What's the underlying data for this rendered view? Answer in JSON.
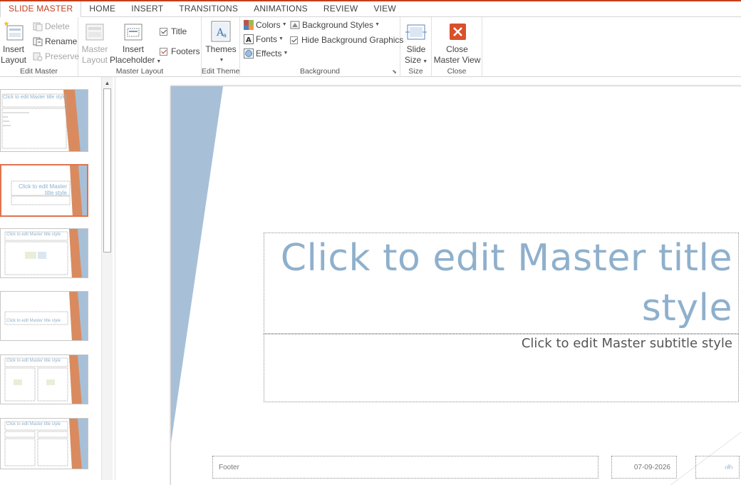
{
  "tabs": [
    "SLIDE MASTER",
    "HOME",
    "INSERT",
    "TRANSITIONS",
    "ANIMATIONS",
    "REVIEW",
    "VIEW"
  ],
  "ribbon": {
    "edit_master": {
      "label": "Edit Master",
      "insert_layout_1": "Insert",
      "insert_layout_2": "Layout",
      "delete": "Delete",
      "rename": "Rename",
      "preserve": "Preserve"
    },
    "master_layout": {
      "label": "Master Layout",
      "master_layout_1": "Master",
      "master_layout_2": "Layout",
      "insert_placeholder_1": "Insert",
      "insert_placeholder_2": "Placeholder",
      "title": "Title",
      "footers": "Footers"
    },
    "edit_theme": {
      "label": "Edit Theme",
      "themes": "Themes"
    },
    "background": {
      "label": "Background",
      "colors": "Colors",
      "fonts": "Fonts",
      "effects": "Effects",
      "background_styles": "Background Styles",
      "hide_background_graphics": "Hide Background Graphics"
    },
    "size": {
      "label": "Size",
      "slide_size_1": "Slide",
      "slide_size_2": "Size"
    },
    "close": {
      "label": "Close",
      "close_master_1": "Close",
      "close_master_2": "Master View"
    }
  },
  "thumbnails": [
    {
      "text": "Click to edit Master title style"
    },
    {
      "text": "Click to edit Master title style"
    },
    {
      "text": "Click to edit Master title style"
    },
    {
      "text": "Click to edit Master title style"
    },
    {
      "text": "Click to edit Master title style"
    },
    {
      "text": "Click to edit Master title style"
    }
  ],
  "slide": {
    "title_line1": "Click to edit Master title",
    "title_line2": "style",
    "subtitle": "Click to edit Master subtitle style",
    "footer": "Footer",
    "date": "07-09-2026",
    "page_number": "‹#›"
  },
  "colors": {
    "accent": "#c43e1c",
    "title_blue": "#8fb0cc",
    "stripe_blue": "#a7c0d8",
    "thumb_orange": "#d98b5f"
  }
}
